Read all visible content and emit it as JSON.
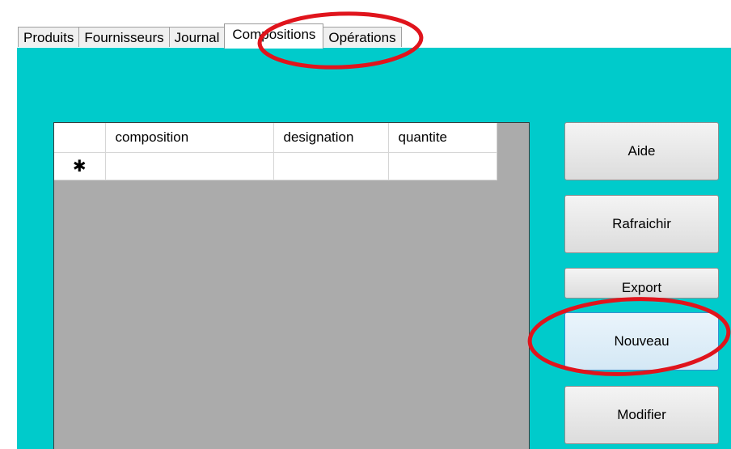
{
  "tabs": [
    {
      "label": "Produits",
      "active": false
    },
    {
      "label": "Fournisseurs",
      "active": false
    },
    {
      "label": "Journal",
      "active": false
    },
    {
      "label": "Compositions",
      "active": true
    },
    {
      "label": "Opérations",
      "active": false
    }
  ],
  "grid": {
    "columns": [
      "",
      "composition",
      "designation",
      "quantite"
    ],
    "new_row_marker": "✱",
    "new_row_cells": [
      "",
      "",
      ""
    ]
  },
  "buttons": {
    "aide": "Aide",
    "rafraichir": "Rafraichir",
    "export": "Export",
    "nouveau": "Nouveau",
    "modifier": "Modifier"
  },
  "colors": {
    "panel_background": "#00cbcb",
    "grid_background": "#ababab",
    "annotation": "#e0141c"
  },
  "annotations": [
    "tab-compositions",
    "nouveau-button"
  ]
}
